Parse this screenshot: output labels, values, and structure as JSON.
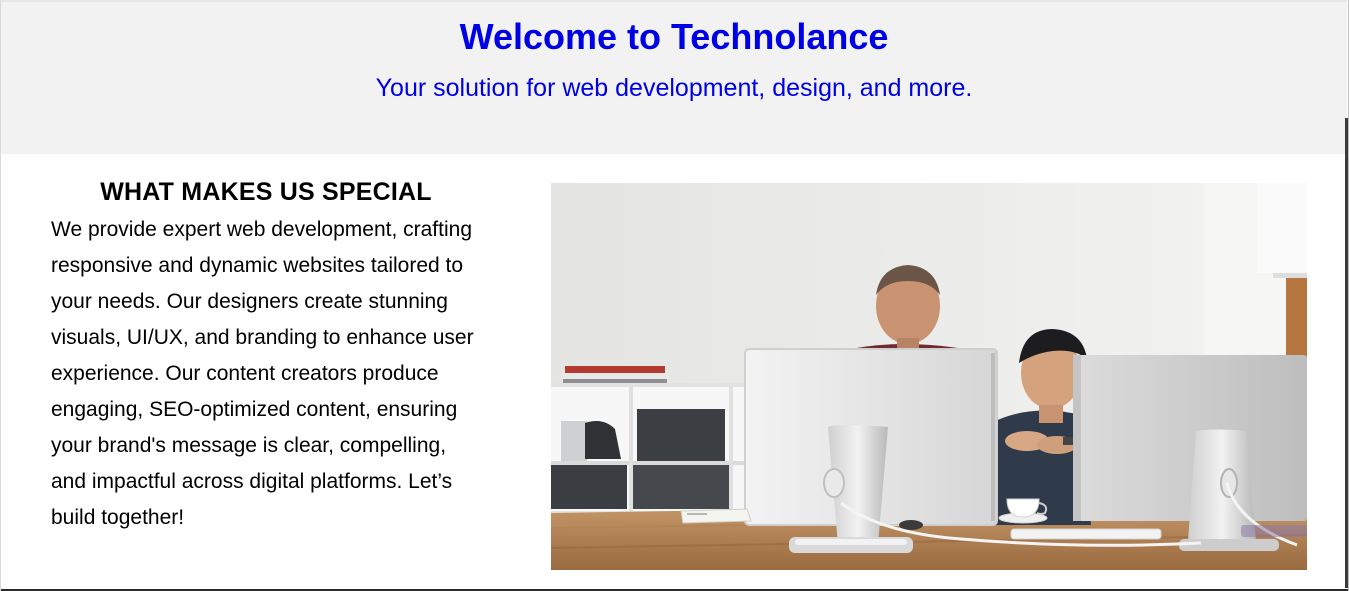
{
  "hero": {
    "title": "Welcome to Technolance",
    "subtitle": "Your solution for web development, design, and more."
  },
  "special": {
    "heading": "WHAT MAKES US SPECIAL",
    "body": "We provide expert web development, crafting responsive and dynamic websites tailored to your needs. Our designers create stunning visuals, UI/UX, and branding to enhance user experience. Our content creators produce engaging, SEO-optimized content, ensuring your brand's message is clear, compelling, and impactful across digital platforms. Let’s build together!"
  },
  "photo": {
    "icon": "office-photo"
  },
  "colors": {
    "accent": "#0000e6",
    "header_bg": "#f2f2f2",
    "text": "#000000"
  }
}
